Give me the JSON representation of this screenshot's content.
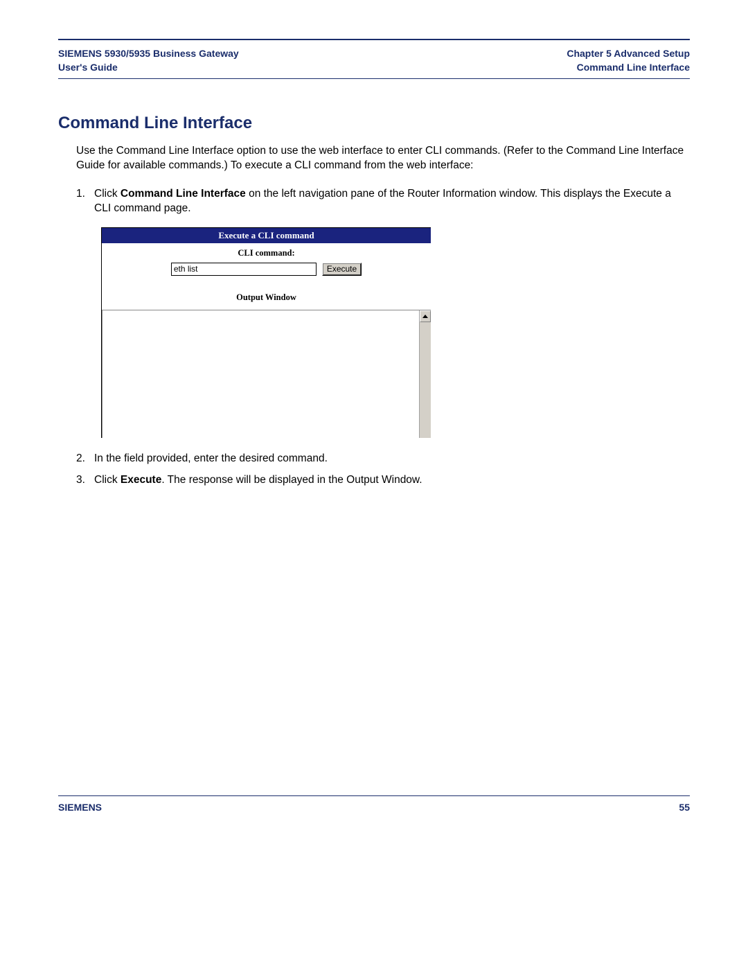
{
  "header": {
    "left_line1": "SIEMENS 5930/5935 Business Gateway",
    "left_line2": "User's Guide",
    "right_line1": "Chapter 5  Advanced Setup",
    "right_line2": "Command Line Interface"
  },
  "section": {
    "title": "Command Line Interface",
    "intro": "Use the Command Line Interface option to use the web interface to enter CLI commands. (Refer to the Command Line Interface Guide for available commands.) To execute a CLI command from the web interface:"
  },
  "steps": {
    "s1_num": "1.",
    "s1_pre": "Click ",
    "s1_bold": "Command Line Interface",
    "s1_post": " on the left navigation pane of the Router Information window. This displays the Execute a CLI command page.",
    "s2_num": "2.",
    "s2_text": "In the field provided, enter the desired command.",
    "s3_num": "3.",
    "s3_pre": "Click ",
    "s3_bold": "Execute",
    "s3_post": ". The response will be displayed in the Output Window."
  },
  "screenshot": {
    "panel_title": "Execute a CLI command",
    "field_label": "CLI command:",
    "field_value": "eth list",
    "button_label": "Execute",
    "output_label": "Output Window"
  },
  "footer": {
    "brand": "SIEMENS",
    "page": "55"
  }
}
